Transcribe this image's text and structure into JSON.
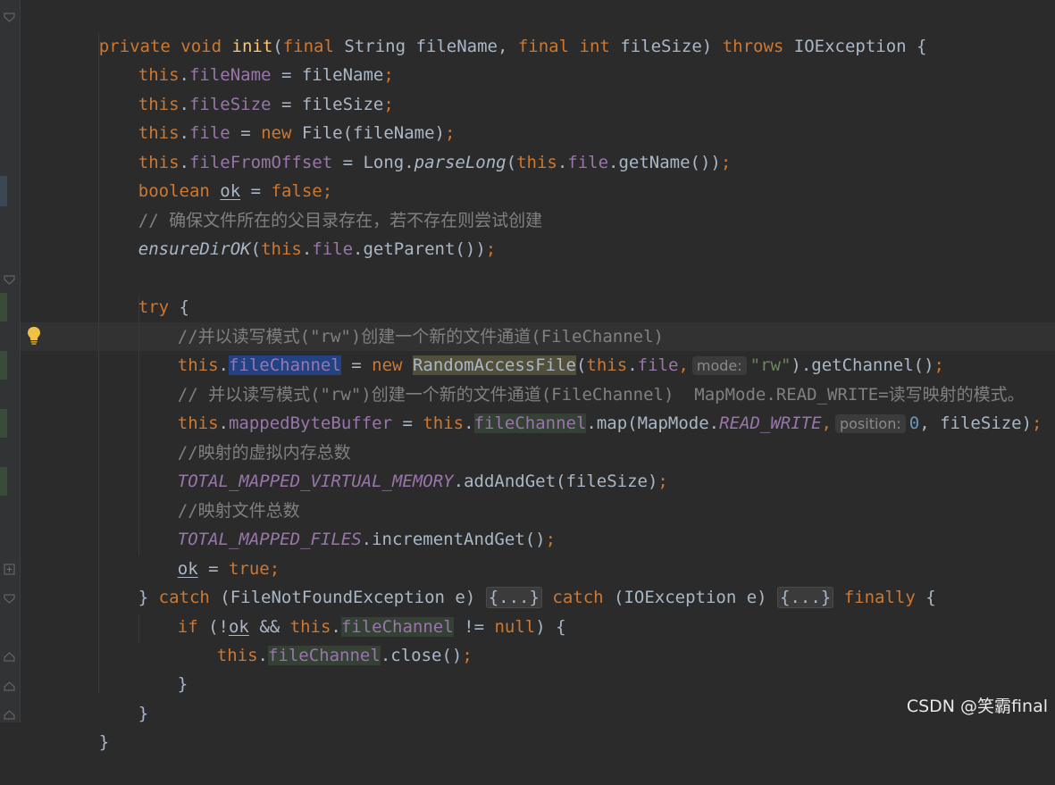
{
  "editor": {
    "signature": {
      "kw_private": "private",
      "kw_void": "void",
      "name": "init",
      "open": "(",
      "kw_final1": "final",
      "type1": "String fileName, ",
      "kw_final2": "final",
      "kw_int": "int",
      "param2": "fileSize) ",
      "kw_throws": "throws",
      "exc": "IOException {"
    },
    "l2": {
      "this": "this",
      "dot": ".",
      "field": "fileName",
      "rest": " = fileName",
      "semi": ";"
    },
    "l3": {
      "this": "this",
      "dot": ".",
      "field": "fileSize",
      "rest": " = fileSize",
      "semi": ";"
    },
    "l4": {
      "this": "this",
      "dot": ".",
      "field": "file",
      "eq": " = ",
      "new": "new",
      "rest": " File(fileName)",
      "semi": ";"
    },
    "l5": {
      "this": "this",
      "dot": ".",
      "field": "fileFromOffset",
      "eq": " = Long.",
      "method": "parseLong",
      "p1": "(",
      "this2": "this",
      "dot2": ".",
      "field2": "file",
      "rest": ".getName())",
      "semi": ";"
    },
    "l6": {
      "kw": "boolean",
      "sp": " ",
      "var": "ok",
      "eq": " = ",
      "val": "false",
      "semi": ";"
    },
    "l7": {
      "comment": "// 确保文件所在的父目录存在，若不存在则尝试创建"
    },
    "l8": {
      "method": "ensureDirOK",
      "p1": "(",
      "this": "this",
      "dot": ".",
      "field": "file",
      "rest": ".getParent())",
      "semi": ";"
    },
    "l10": {
      "kw": "try",
      "rest": " {"
    },
    "l11": {
      "comment": "//并以读写模式(\"rw\")创建一个新的文件通道(FileChannel)"
    },
    "l12": {
      "this": "this",
      "dot": ".",
      "field": "fileChannel",
      "eq": " = ",
      "new": "new",
      "sp": " ",
      "cls": "RandomAccessFile",
      "p1": "(",
      "this2": "this",
      "dot2": ".",
      "field2": "file",
      "comma": ",",
      "hint": "mode:",
      "str": "\"rw\"",
      "rest": ").getChannel()",
      "semi": ";"
    },
    "l13": {
      "comment": "// 并以读写模式(\"rw\")创建一个新的文件通道(FileChannel)  MapMode.READ_WRITE=读写映射的模式。"
    },
    "l14": {
      "this": "this",
      "dot": ".",
      "field": "mappedByteBuffer",
      "eq": " = ",
      "this2": "this",
      "dot2": ".",
      "field2": "fileChannel",
      "rest": ".map(MapMode.",
      "const": "READ_WRITE",
      "comma": ",",
      "hint": "position:",
      "num": "0",
      "rest2": ", fileSize)",
      "semi": ";"
    },
    "l15": {
      "comment": "//映射的虚拟内存总数"
    },
    "l16": {
      "const": "TOTAL_MAPPED_VIRTUAL_MEMORY",
      "rest": ".addAndGet(fileSize)",
      "semi": ";"
    },
    "l17": {
      "comment": "//映射文件总数"
    },
    "l18": {
      "const": "TOTAL_MAPPED_FILES",
      "rest": ".incrementAndGet()",
      "semi": ";"
    },
    "l19": {
      "var": "ok",
      "eq": " = ",
      "val": "true",
      "semi": ";"
    },
    "l20": {
      "brace": "} ",
      "catch1": "catch",
      "exc1": " (FileNotFoundException e) ",
      "fold1": "{...}",
      "sp": " ",
      "catch2": "catch",
      "exc2": " (IOException e) ",
      "fold2": "{...}",
      "sp2": " ",
      "fin": "finally",
      "rest": " {"
    },
    "l21": {
      "kw_if": "if",
      "p1": " (!",
      "var": "ok",
      "and": " && ",
      "this": "this",
      "dot": ".",
      "field": "fileChannel",
      "ne": " != ",
      "null": "null",
      "rest": ") {"
    },
    "l22": {
      "this": "this",
      "dot": ".",
      "field": "fileChannel",
      "rest": ".close()",
      "semi": ";"
    },
    "l23": {
      "brace": "}"
    },
    "l24": {
      "brace": "}"
    },
    "l25": {
      "brace": "}"
    }
  },
  "watermark": "CSDN @笑霸final"
}
